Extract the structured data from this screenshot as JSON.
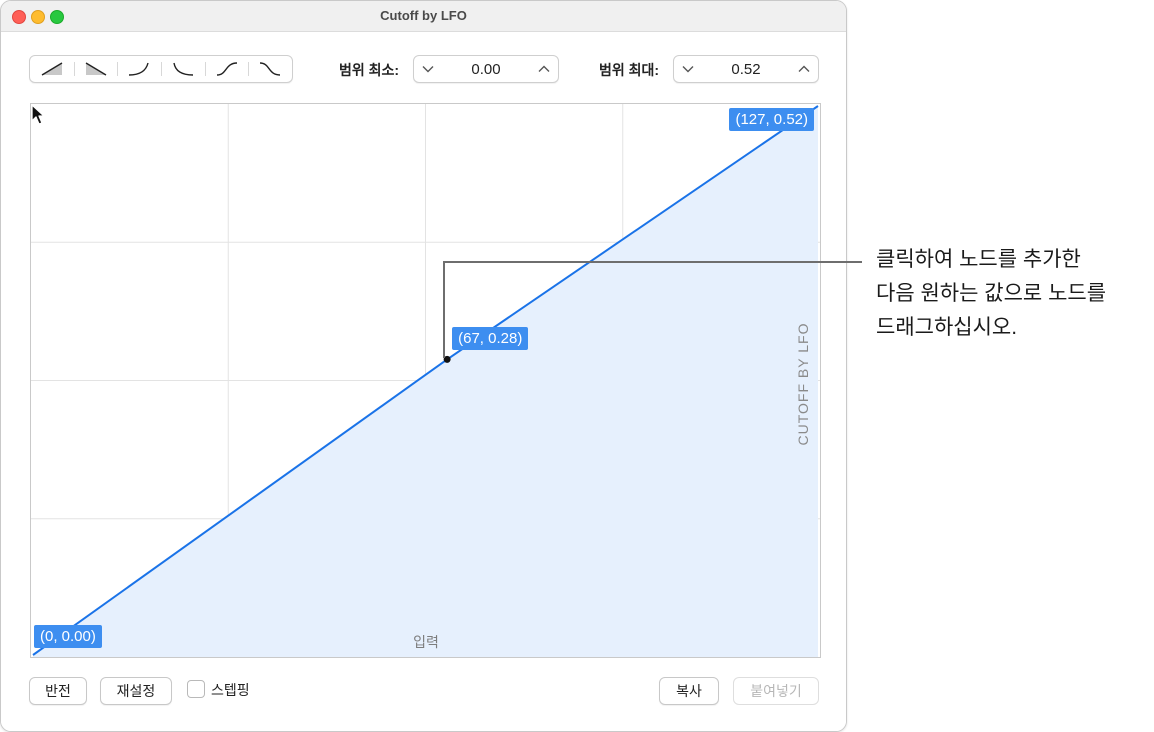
{
  "window": {
    "title": "Cutoff by LFO"
  },
  "toolbar": {
    "curve_presets": [
      "linear-up-icon",
      "linear-down-icon",
      "convex-up-icon",
      "concave-down-icon",
      "s-curve-up-icon",
      "s-curve-down-icon"
    ],
    "range_min_label": "범위 최소:",
    "range_min_value": "0.00",
    "range_max_label": "범위 최대:",
    "range_max_value": "0.52"
  },
  "graph": {
    "x_axis_label": "입력",
    "y_axis_label": "CUTOFF BY LFO",
    "x_range": [
      0,
      127
    ],
    "y_range": [
      0.0,
      0.52
    ],
    "nodes": [
      {
        "x": 0,
        "y": 0.0,
        "label": "(0, 0.00)"
      },
      {
        "x": 67,
        "y": 0.28,
        "label": "(67, 0.28)"
      },
      {
        "x": 127,
        "y": 0.52,
        "label": "(127, 0.52)"
      }
    ],
    "line_color": "#1a73e8",
    "fill_color": "#e6f0fd",
    "badge_color": "#3d8ef0"
  },
  "footer": {
    "invert_label": "반전",
    "reset_label": "재설정",
    "stepping_label": "스텝핑",
    "stepping_checked": false,
    "copy_label": "복사",
    "paste_label": "붙여넣기"
  },
  "annotation": {
    "lines": [
      "클릭하여 노드를 추가한",
      "다음 원하는 값으로 노드를",
      "드래그하십시오."
    ]
  }
}
